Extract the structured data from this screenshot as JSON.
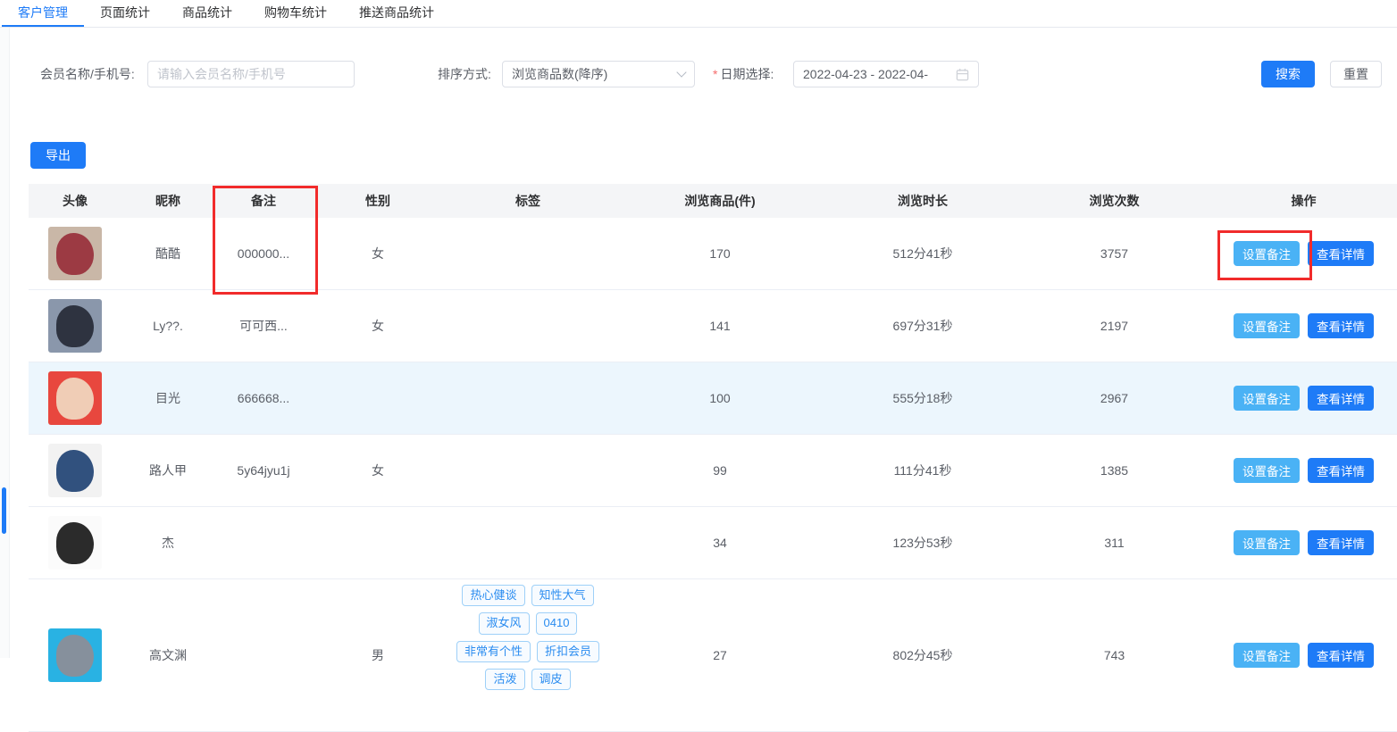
{
  "tabs": [
    {
      "label": "客户管理",
      "active": true
    },
    {
      "label": "页面统计",
      "active": false
    },
    {
      "label": "商品统计",
      "active": false
    },
    {
      "label": "购物车统计",
      "active": false
    },
    {
      "label": "推送商品统计",
      "active": false
    }
  ],
  "filters": {
    "member_label": "会员名称/手机号:",
    "member_placeholder": "请输入会员名称/手机号",
    "member_value": "",
    "sort_label": "排序方式:",
    "sort_value": "浏览商品数(降序)",
    "date_required_mark": "*",
    "date_label": "日期选择:",
    "date_value": "2022-04-23 - 2022-04-",
    "search_button": "搜索",
    "reset_button": "重置"
  },
  "toolbar": {
    "export_button": "导出"
  },
  "table": {
    "columns": [
      "头像",
      "昵称",
      "备注",
      "性别",
      "标签",
      "浏览商品(件)",
      "浏览时长",
      "浏览次数",
      "操作"
    ],
    "actions": {
      "set_remark": "设置备注",
      "view_detail": "查看详情"
    },
    "rows": [
      {
        "nickname": "酷酷",
        "remark": "000000...",
        "gender": "女",
        "tags": [],
        "items": "170",
        "duration": "512分41秒",
        "views": "3757",
        "highlight": false,
        "avatar": {
          "c1": "#c9b7a7",
          "c2": "#9c3a43"
        }
      },
      {
        "nickname": "Ly??.",
        "remark": "可可西...",
        "gender": "女",
        "tags": [],
        "items": "141",
        "duration": "697分31秒",
        "views": "2197",
        "highlight": false,
        "avatar": {
          "c1": "#8a97ab",
          "c2": "#2e3340"
        }
      },
      {
        "nickname": "目光",
        "remark": "666668...",
        "gender": "",
        "tags": [],
        "items": "100",
        "duration": "555分18秒",
        "views": "2967",
        "highlight": true,
        "avatar": {
          "c1": "#e8473e",
          "c2": "#f0cdb6"
        }
      },
      {
        "nickname": "路人甲",
        "remark": "5y64jyu1j",
        "gender": "女",
        "tags": [],
        "items": "99",
        "duration": "111分41秒",
        "views": "1385",
        "highlight": false,
        "avatar": {
          "c1": "#f2f2f2",
          "c2": "#31517e"
        }
      },
      {
        "nickname": "杰",
        "remark": "",
        "gender": "",
        "tags": [],
        "items": "34",
        "duration": "123分53秒",
        "views": "311",
        "highlight": false,
        "avatar": {
          "c1": "#fbfbfb",
          "c2": "#2b2b2b"
        }
      },
      {
        "nickname": "高文渊",
        "remark": "",
        "gender": "男",
        "tags": [
          "热心健谈",
          "知性大气",
          "淑女风",
          "0410",
          "非常有个性",
          "折扣会员",
          "活泼",
          "调皮"
        ],
        "items": "27",
        "duration": "802分45秒",
        "views": "743",
        "highlight": false,
        "avatar": {
          "c1": "#29b2e3",
          "c2": "#86909c"
        }
      }
    ]
  },
  "colors": {
    "primary_blue": "#1e7bf7",
    "light_blue": "#4ab2f5",
    "annotation_red": "#f12b2b",
    "tag_blue": "#2a8cf0",
    "highlight_row": "#ecf6fd"
  }
}
